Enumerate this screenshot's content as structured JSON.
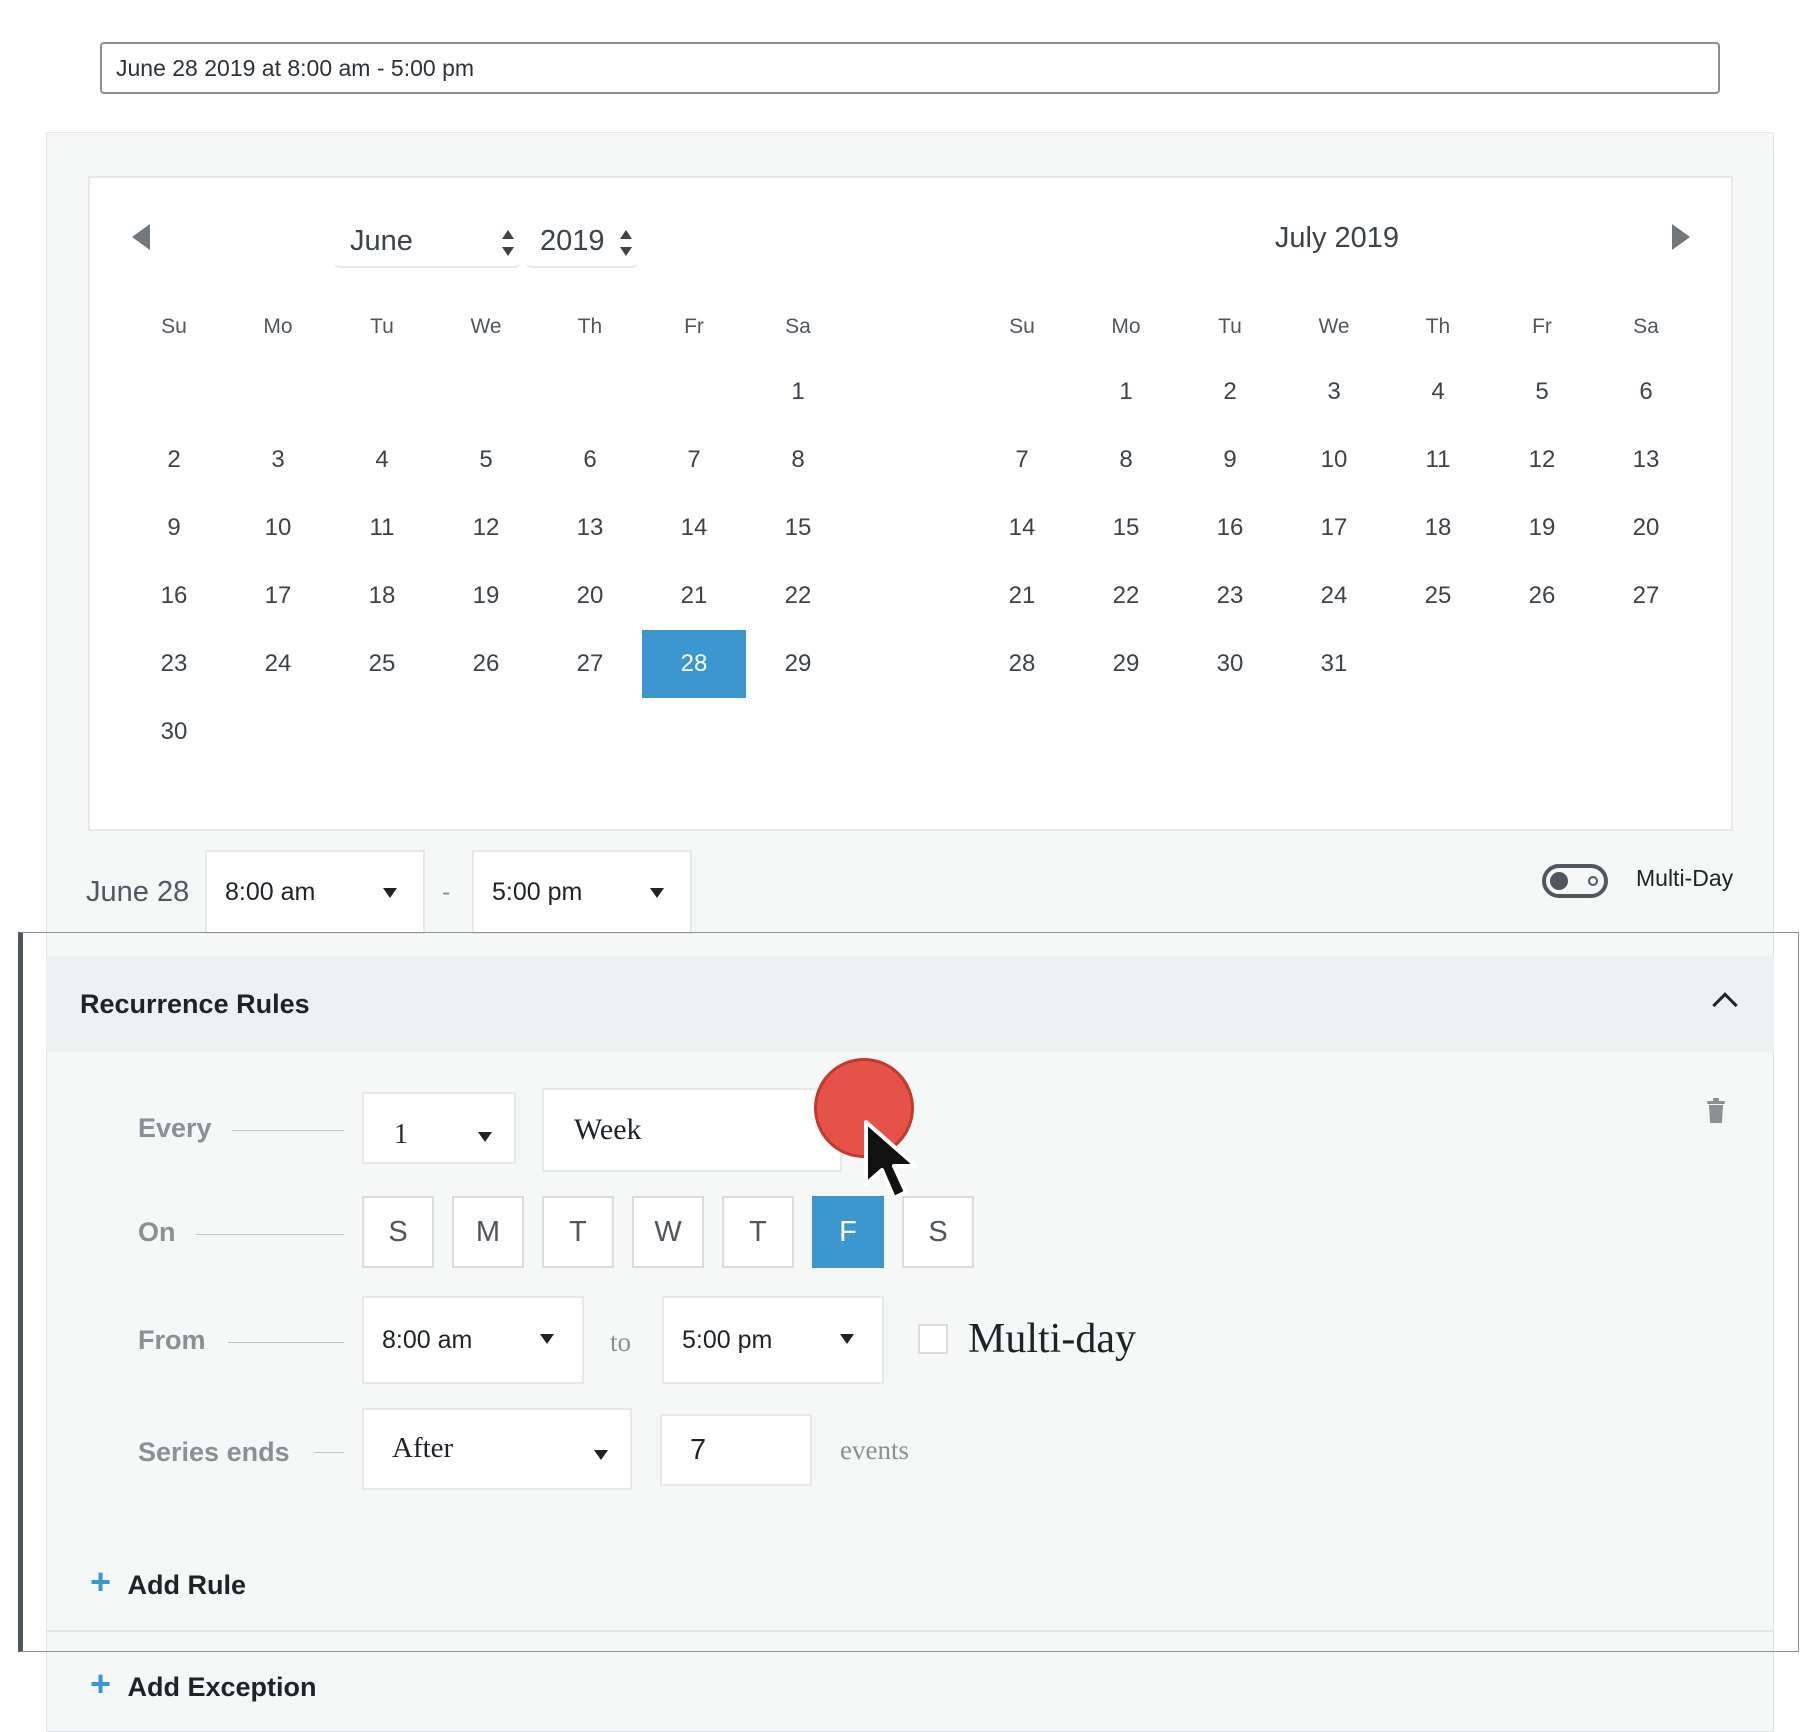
{
  "summary": {
    "value": "June 28 2019 at 8:00 am - 5:00 pm"
  },
  "calendar": {
    "month_select": "June",
    "year_select": "2019",
    "right_title": "July 2019",
    "weekdays": [
      "Su",
      "Mo",
      "Tu",
      "We",
      "Th",
      "Fr",
      "Sa"
    ],
    "june_days": [
      "1",
      "2",
      "3",
      "4",
      "5",
      "6",
      "7",
      "8",
      "9",
      "10",
      "11",
      "12",
      "13",
      "14",
      "15",
      "16",
      "17",
      "18",
      "19",
      "20",
      "21",
      "22",
      "23",
      "24",
      "25",
      "26",
      "27",
      "28",
      "29",
      "30"
    ],
    "june_first_weekday_index": 6,
    "july_days": [
      "1",
      "2",
      "3",
      "4",
      "5",
      "6",
      "7",
      "8",
      "9",
      "10",
      "11",
      "12",
      "13",
      "14",
      "15",
      "16",
      "17",
      "18",
      "19",
      "20",
      "21",
      "22",
      "23",
      "24",
      "25",
      "26",
      "27",
      "28",
      "29",
      "30",
      "31"
    ],
    "july_first_weekday_index": 1,
    "selected_day": "28",
    "selected_color": "#3c97cf"
  },
  "date_row": {
    "label": "June 28",
    "start_time": "8:00 am",
    "separator": "-",
    "end_time": "5:00 pm",
    "multiday_label": "Multi-Day"
  },
  "recurrence": {
    "title": "Recurrence Rules",
    "every_label": "Every",
    "every_value": "1",
    "interval_value": "Week",
    "on_label": "On",
    "days": [
      "S",
      "M",
      "T",
      "W",
      "T",
      "F",
      "S"
    ],
    "active_day_index": 5,
    "from_label": "From",
    "from_time": "8:00 am",
    "to_label": "to",
    "to_time": "5:00 pm",
    "multiday_label": "Multi-day",
    "series_ends_label": "Series ends",
    "series_ends_value": "After",
    "count_value": "7",
    "count_unit": "events",
    "add_rule": "Add Rule",
    "add_exception": "Add Exception",
    "plus": "+"
  },
  "icons": {
    "prev": "arrow-left-icon",
    "next": "arrow-right-icon",
    "collapse": "chevron-up-icon",
    "delete": "trash-icon",
    "cursor": "mouse-pointer-icon"
  }
}
